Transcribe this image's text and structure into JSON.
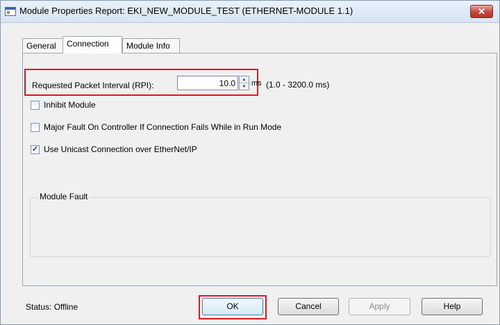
{
  "window": {
    "title": "Module Properties Report: EKI_NEW_MODULE_TEST (ETHERNET-MODULE 1.1)",
    "close_symbol": "✕"
  },
  "tabs": [
    {
      "label": "General",
      "active": false
    },
    {
      "label": "Connection",
      "active": true
    },
    {
      "label": "Module Info",
      "active": false
    }
  ],
  "connection": {
    "rpi_label": "Requested Packet Interval (RPI):",
    "rpi_value": "10.0",
    "rpi_unit": "ms",
    "rpi_range": "(1.0 - 3200.0 ms)",
    "options": [
      {
        "label": "Inhibit Module",
        "checked": false
      },
      {
        "label": "Major Fault On Controller If Connection Fails While in Run Mode",
        "checked": false
      },
      {
        "label": "Use Unicast Connection over EtherNet/IP",
        "checked": true
      }
    ],
    "module_fault_label": "Module Fault"
  },
  "footer": {
    "status": "Status:  Offline",
    "ok_label": "OK",
    "cancel_label": "Cancel",
    "apply_label": "Apply",
    "help_label": "Help"
  },
  "colors": {
    "highlight": "#e8141b"
  }
}
